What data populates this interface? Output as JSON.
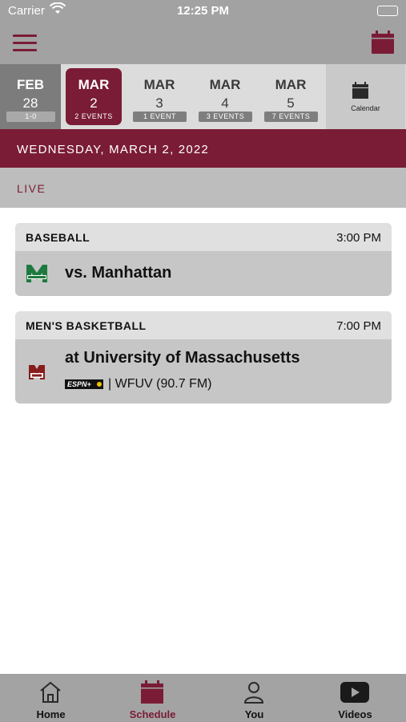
{
  "status_bar": {
    "carrier": "Carrier",
    "time": "12:25 PM"
  },
  "date_strip": {
    "days": [
      {
        "month": "FEB",
        "day": "28",
        "badge": "1-0",
        "state": "past"
      },
      {
        "month": "MAR",
        "day": "2",
        "badge": "2 EVENTS",
        "state": "selected"
      },
      {
        "month": "MAR",
        "day": "3",
        "badge": "1 EVENT",
        "state": "normal"
      },
      {
        "month": "MAR",
        "day": "4",
        "badge": "3 EVENTS",
        "state": "normal"
      },
      {
        "month": "MAR",
        "day": "5",
        "badge": "7 EVENTS",
        "state": "normal"
      }
    ],
    "calendar_label": "Calendar"
  },
  "date_header": "WEDNESDAY, MARCH 2, 2022",
  "section_label": "LIVE",
  "events": [
    {
      "sport": "BASEBALL",
      "time": "3:00 PM",
      "opponent": "vs. Manhattan",
      "team_logo": "manhattan-jaspers-logo"
    },
    {
      "sport": "MEN'S BASKETBALL",
      "time": "7:00 PM",
      "opponent": "at University of Massachusetts",
      "team_logo": "umass-logo",
      "broadcast_network": "ESPN+",
      "broadcast_radio": "| WFUV (90.7 FM)"
    }
  ],
  "tabs": [
    {
      "label": "Home",
      "icon": "home-icon"
    },
    {
      "label": "Schedule",
      "icon": "calendar-icon",
      "active": true
    },
    {
      "label": "You",
      "icon": "person-icon"
    },
    {
      "label": "Videos",
      "icon": "play-icon"
    }
  ],
  "colors": {
    "accent": "#7a1c36",
    "bar_gray": "#a2a2a2",
    "strip_gray": "#dcdcdc",
    "card_gray": "#c6c6c6"
  }
}
